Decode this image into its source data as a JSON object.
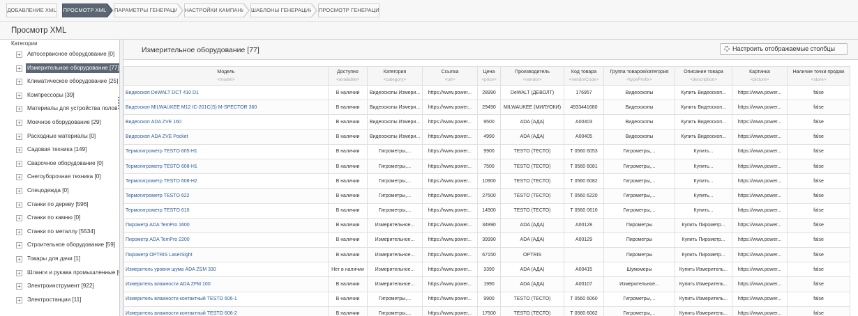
{
  "steps": [
    {
      "label": "ДОБАВЛЕНИЕ XML",
      "active": false
    },
    {
      "label": "ПРОСМОТР XML",
      "active": true
    },
    {
      "label": "ПАРАМЕТРЫ ГЕНЕРАЦИИ",
      "active": false
    },
    {
      "label": "НАСТРОЙКИ КАМПАНИЙ",
      "active": false
    },
    {
      "label": "ШАБЛОНЫ ГЕНЕРАЦИИ",
      "active": false
    },
    {
      "label": "ПРОСМОТР ГЕНЕРАЦИИ",
      "active": false
    }
  ],
  "page_title": "Просмотр XML",
  "sidebar": {
    "heading": "Категории",
    "items": [
      {
        "label": "Автосервисное оборудование [0]",
        "selected": false
      },
      {
        "label": "Измерительное оборудование [77]",
        "selected": true
      },
      {
        "label": "Климатическое оборудование [25]",
        "selected": false
      },
      {
        "label": "Компрессоры [39]",
        "selected": false
      },
      {
        "label": "Материалы для устройства полов [0",
        "selected": false
      },
      {
        "label": "Моечное оборудование [29]",
        "selected": false
      },
      {
        "label": "Расходные материалы [0]",
        "selected": false
      },
      {
        "label": "Садовая техника [149]",
        "selected": false
      },
      {
        "label": "Сварочное оборудование [0]",
        "selected": false
      },
      {
        "label": "Снегоуборочная техника [0]",
        "selected": false
      },
      {
        "label": "Спецодежда [0]",
        "selected": false
      },
      {
        "label": "Станки по дереву [596]",
        "selected": false
      },
      {
        "label": "Станки по камню [0]",
        "selected": false
      },
      {
        "label": "Станки по металлу [5534]",
        "selected": false
      },
      {
        "label": "Строительное оборудование [59]",
        "selected": false
      },
      {
        "label": "Товары для дачи [1]",
        "selected": false
      },
      {
        "label": "Шланги и рукава промышленные [0",
        "selected": false
      },
      {
        "label": "Электроинструмент [922]",
        "selected": false
      },
      {
        "label": "Электростанции [11]",
        "selected": false
      }
    ]
  },
  "main": {
    "title": "Измерительное оборудование [77]",
    "columns_button": "Настроить отображаемые столбцы",
    "icons": {
      "columns_button": "gear-icon",
      "category_expand": "plus-icon"
    }
  },
  "table": {
    "columns": [
      {
        "label": "Модель",
        "key": "<model>"
      },
      {
        "label": "Доступно",
        "key": "<available>"
      },
      {
        "label": "Категория",
        "key": "<category>"
      },
      {
        "label": "Ссылка",
        "key": "<url>"
      },
      {
        "label": "Цена",
        "key": "<price>"
      },
      {
        "label": "Производитель",
        "key": "<vendor>"
      },
      {
        "label": "Код товара",
        "key": "<vendorCode>"
      },
      {
        "label": "Группа товаров/категория",
        "key": "<typePrefix>"
      },
      {
        "label": "Описание товара",
        "key": "<description>"
      },
      {
        "label": "Картинка",
        "key": "<picture>"
      },
      {
        "label": "Наличие точки продаж",
        "key": "<store>"
      }
    ],
    "rows": [
      [
        "Видеоскоп DeWALT DCT 410 D1",
        "В наличии",
        "Видеоскопы Измери...",
        "https://www.power...",
        "28990",
        "DeWALT (ДЕВОЛТ)",
        "176957",
        "Видеоскопы",
        "Купить Видеоскоп...",
        "https://www.power...",
        "false"
      ],
      [
        "Видеоскоп MILWAUKEE M12 IC-201C(S) M-SPECTOR 360",
        "В наличии",
        "Видеоскопы Измери...",
        "https://www.power...",
        "29490",
        "MILWAUKEE (МИЛУОКИ)",
        "4933441680",
        "Видеоскопы",
        "Купить Видеоскоп...",
        "https://www.power...",
        "false"
      ],
      [
        "Видеоскоп ADA ZVE 160",
        "В наличии",
        "Видеоскопы Измери...",
        "https://www.power...",
        "9500",
        "ADA (АДА)",
        "A00403",
        "Видеоскопы",
        "Купить Видеоскоп...",
        "https://www.power...",
        "false"
      ],
      [
        "Видеоскоп ADA ZVE Pocket",
        "В наличии",
        "Видеоскопы Измери...",
        "https://www.power...",
        "4990",
        "ADA (АДА)",
        "A00405",
        "Видеоскопы",
        "Купить Видеоскоп...",
        "https://www.power...",
        "false"
      ],
      [
        "Термогигрометр TESTO 605-H1",
        "В наличии",
        "Гигрометры,...",
        "https://www.power...",
        "9900",
        "TESTO (ТЕСТО)",
        "Т 0560 6053",
        "Гигрометры,...",
        "Купить...",
        "https://www.power...",
        "false"
      ],
      [
        "Термогигрометр TESTO 608-H1",
        "В наличии",
        "Гигрометры,...",
        "https://www.power...",
        "7500",
        "TESTO (ТЕСТО)",
        "Т 0560 6081",
        "Гигрометры,...",
        "Купить...",
        "https://www.power...",
        "false"
      ],
      [
        "Термогигрометр TESTO 608-H2",
        "В наличии",
        "Гигрометры,...",
        "https://www.power...",
        "10900",
        "TESTO (ТЕСТО)",
        "Т 0560 6082",
        "Гигрометры,...",
        "Купить...",
        "https://www.power...",
        "false"
      ],
      [
        "Термогигрометр TESTO 622",
        "В наличии",
        "Гигрометры,...",
        "https://www.power...",
        "27500",
        "TESTO (ТЕСТО)",
        "Т 0560 6220",
        "Гигрометры,...",
        "Купить...",
        "https://www.power...",
        "false"
      ],
      [
        "Термогигрометр TESTO 610",
        "В наличии",
        "Гигрометры,...",
        "https://www.power...",
        "14900",
        "TESTO (ТЕСТО)",
        "Т 0560 0610",
        "Гигрометры,...",
        "Купить...",
        "https://www.power...",
        "false"
      ],
      [
        "Пирометр ADA TemPro 1600",
        "В наличии",
        "Измерительное...",
        "https://www.power...",
        "34990",
        "ADA (АДА)",
        "A00128",
        "Пирометры",
        "Купить Пирометр...",
        "https://www.power...",
        "false"
      ],
      [
        "Пирометр ADA TemPro 2200",
        "В наличии",
        "Измерительное...",
        "https://www.power...",
        "39990",
        "ADA (АДА)",
        "A00129",
        "Пирометры",
        "Купить Пирометр...",
        "https://www.power...",
        "false"
      ],
      [
        "Пирометр OPTRIS LaserSight",
        "В наличии",
        "Измерительное...",
        "https://www.power...",
        "67150",
        "OPTRIS",
        "",
        "Пирометры",
        "Купить Пирометр...",
        "https://www.power...",
        "false"
      ],
      [
        "Измеритель уровня шума ADA ZSM 330",
        "Нет в наличии",
        "Измерительное...",
        "https://www.power...",
        "3390",
        "ADA (АДА)",
        "A00415",
        "Шумомеры",
        "Купить Измеритель...",
        "https://www.power...",
        "false"
      ],
      [
        "Измеритель влажности ADA ZFM 100",
        "В наличии",
        "Измерительное...",
        "https://www.power...",
        "1990",
        "ADA (АДА)",
        "A00107",
        "Измерительное...",
        "Купить Измеритель...",
        "https://www.power...",
        "false"
      ],
      [
        "Измеритель влажности контактный TESTO 606-1",
        "В наличии",
        "Гигрометры,...",
        "https://www.power...",
        "9900",
        "TESTO (ТЕСТО)",
        "Т 0560 6060",
        "Гигрометры,...",
        "Купить Измеритель...",
        "https://www.power...",
        "false"
      ],
      [
        "Измеритель влажности контактный TESTO 606-2",
        "В наличии",
        "Гигрометры,...",
        "https://www.power...",
        "17500",
        "TESTO (ТЕСТО)",
        "Т 0560 6062",
        "Гигрометры,...",
        "Купить Измеритель...",
        "https://www.power...",
        "false"
      ]
    ]
  }
}
